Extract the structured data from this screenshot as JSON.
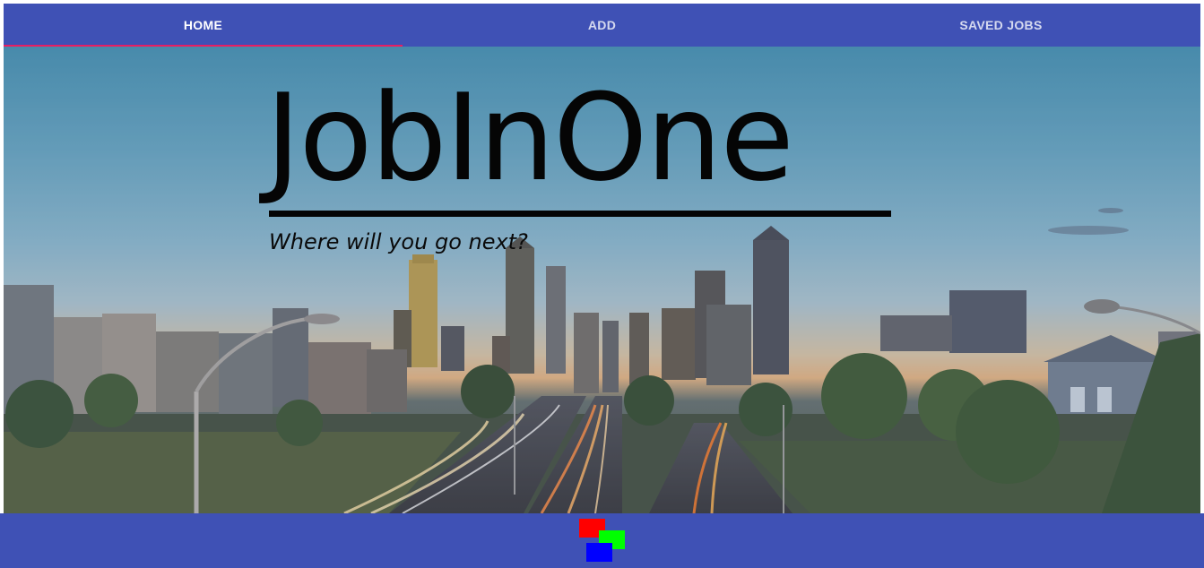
{
  "tabs": [
    {
      "label": "HOME",
      "active": true
    },
    {
      "label": "ADD",
      "active": false
    },
    {
      "label": "SAVED JOBS",
      "active": false
    }
  ],
  "hero": {
    "title": "JobInOne",
    "tagline": "Where will you go next?",
    "background": "city-skyline-highway-photo"
  },
  "colors": {
    "appbar": "#3f51b5",
    "tab_indicator": "#e91e63",
    "logo_red": "#ff0000",
    "logo_green": "#00ff00",
    "logo_blue": "#0000ff"
  },
  "footer": {
    "logo": "rgb-squares-logo-icon"
  }
}
